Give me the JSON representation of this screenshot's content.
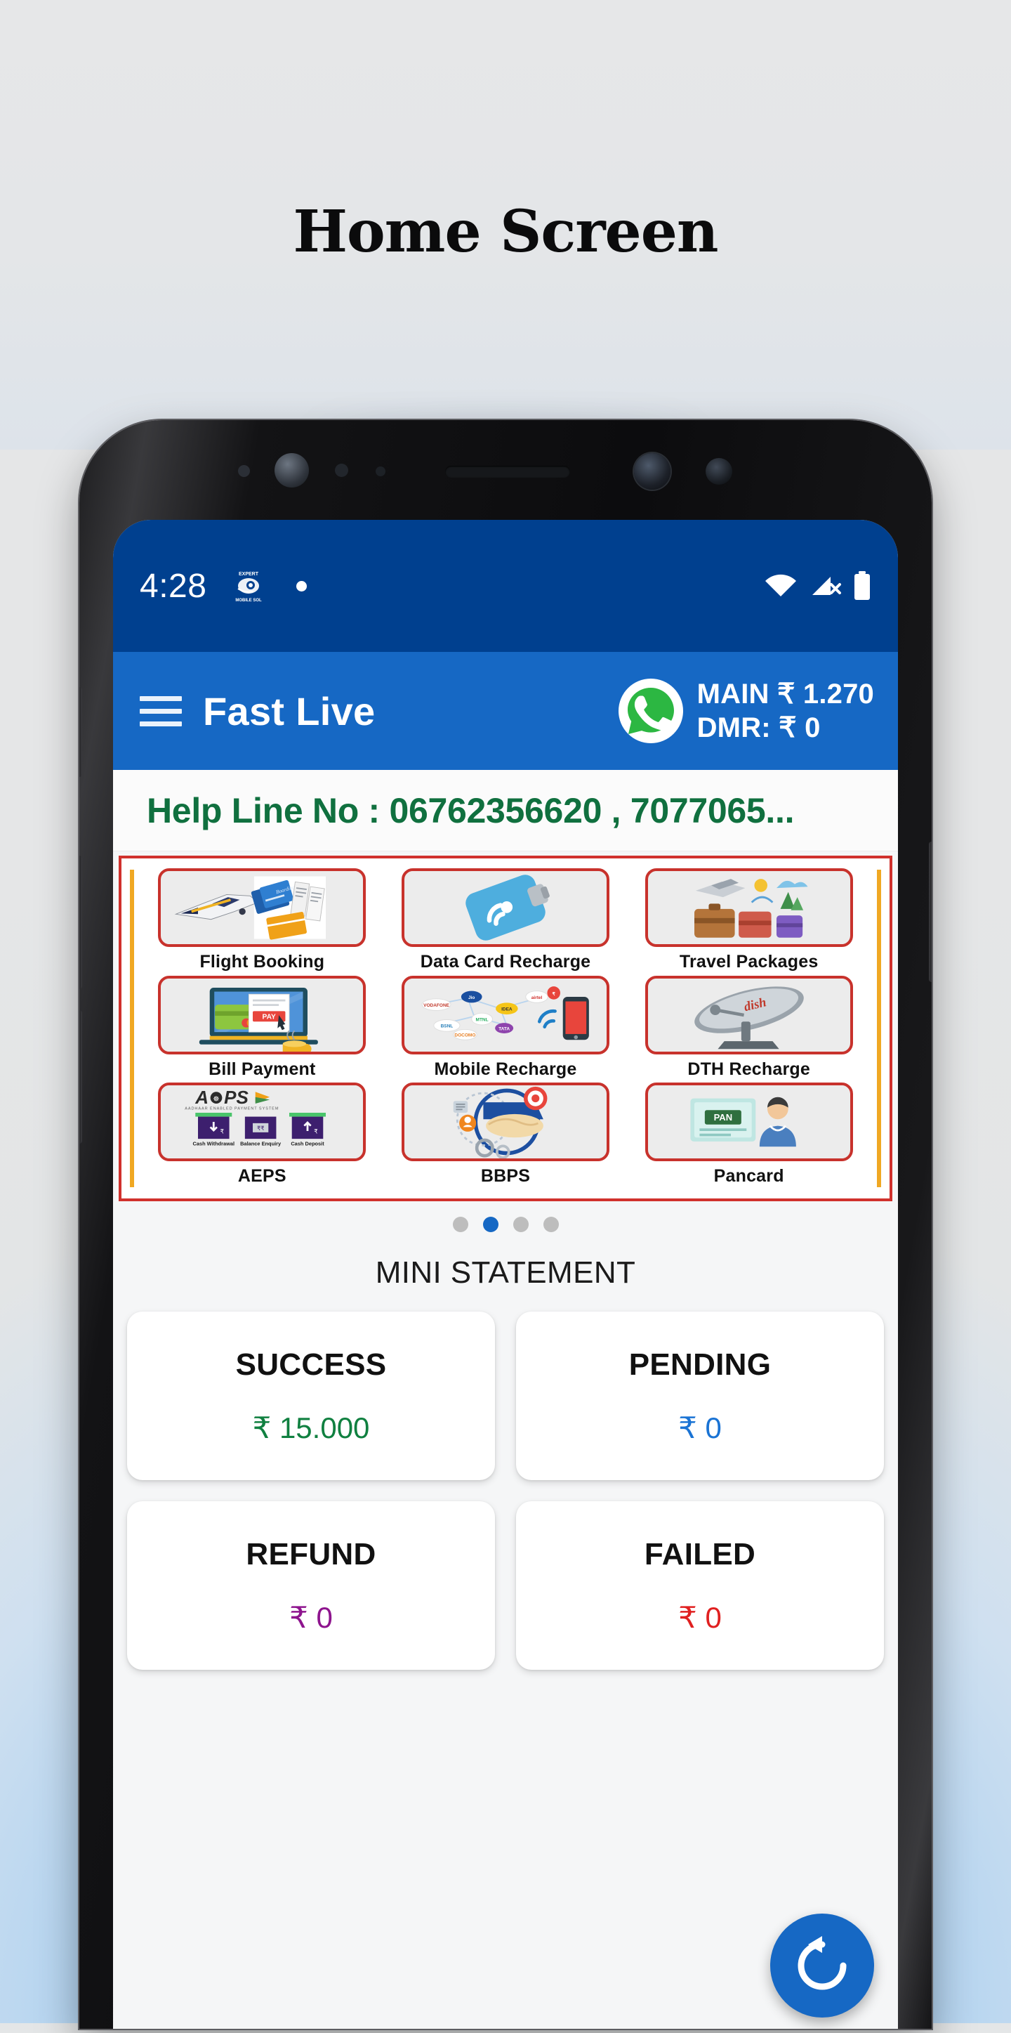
{
  "page": {
    "title": "Home Screen"
  },
  "status_bar": {
    "time": "4:28",
    "app_icon": "app-badge-icon",
    "notification_dot": "notification-dot-icon",
    "wifi_icon": "wifi-icon",
    "signal_icon": "signal-no-sim-icon",
    "battery_icon": "battery-full-icon",
    "background_color": "#00408f"
  },
  "app_bar": {
    "menu_icon": "hamburger-menu-icon",
    "title": "Fast Live",
    "whatsapp_icon": "whatsapp-icon",
    "main_balance_label": "MAIN",
    "main_balance_value": "₹ 1.270",
    "dmr_balance_label": "DMR:",
    "dmr_balance_value": "₹ 0",
    "background_color": "#1668c4"
  },
  "helpline": {
    "text": "Help Line No : 06762356620 , 7077065...",
    "color": "#10703f"
  },
  "services": {
    "border_color": "#d0312d",
    "tiles": [
      {
        "label": "Flight Booking",
        "icon": "flight-booking-icon"
      },
      {
        "label": "Data Card Recharge",
        "icon": "data-card-recharge-icon"
      },
      {
        "label": "Travel Packages",
        "icon": "travel-packages-icon"
      },
      {
        "label": "Bill Payment",
        "icon": "bill-payment-icon"
      },
      {
        "label": "Mobile Recharge",
        "icon": "mobile-recharge-icon"
      },
      {
        "label": "DTH Recharge",
        "icon": "dth-recharge-icon"
      },
      {
        "label": "AEPS",
        "icon": "aeps-icon"
      },
      {
        "label": "BBPS",
        "icon": "bbps-icon"
      },
      {
        "label": "Pancard",
        "icon": "pancard-icon"
      }
    ]
  },
  "carousel": {
    "total_pages": 4,
    "active_page": 2
  },
  "mini_statement": {
    "heading": "MINI STATEMENT",
    "cards": [
      {
        "title": "SUCCESS",
        "value": "₹ 15.000",
        "color": "#108040"
      },
      {
        "title": "PENDING",
        "value": "₹ 0",
        "color": "#1a73d4"
      },
      {
        "title": "REFUND",
        "value": "₹ 0",
        "color": "#8e148e"
      },
      {
        "title": "FAILED",
        "value": "₹ 0",
        "color": "#e02020"
      }
    ]
  },
  "fab": {
    "icon": "refresh-icon",
    "color": "#1668c4"
  }
}
